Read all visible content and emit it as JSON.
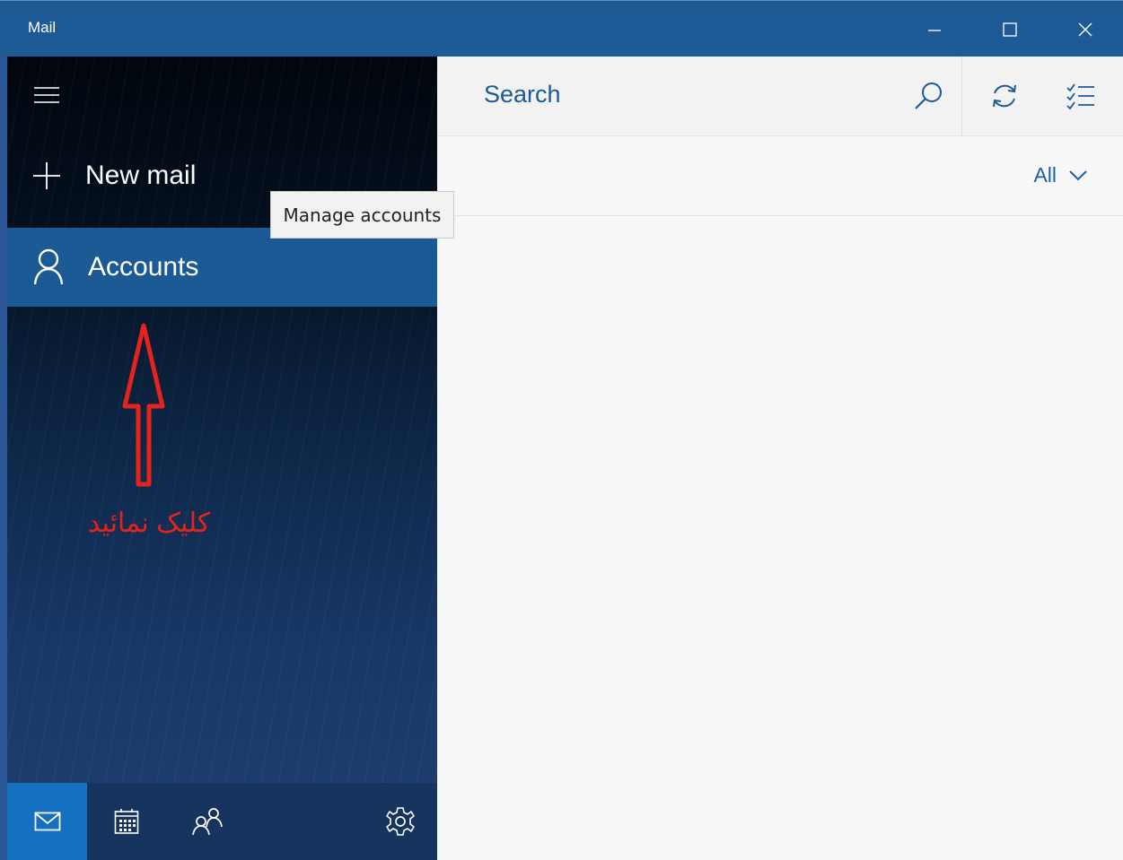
{
  "window": {
    "title": "Mail",
    "controls": {
      "minimize": "minimize",
      "maximize": "maximize",
      "close": "close"
    }
  },
  "sidebar": {
    "menu_icon": "hamburger-icon",
    "new_mail_label": "New mail",
    "accounts_label": "Accounts",
    "annotation_text": "کلیک نمائید",
    "annotation_color": "#e3231c",
    "accent_color": "#1b5a94",
    "bottom_nav": [
      "mail-icon",
      "calendar-icon",
      "people-icon",
      "settings-icon"
    ]
  },
  "tooltip": {
    "text": "Manage accounts"
  },
  "main": {
    "search_placeholder": "Search",
    "filter_label": "All"
  }
}
